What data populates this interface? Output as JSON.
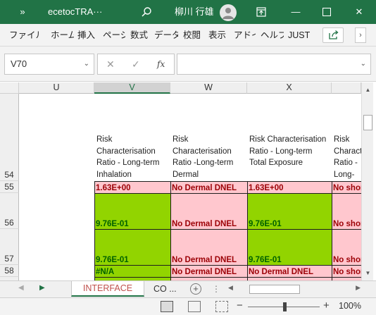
{
  "titlebar": {
    "overflow_glyph": "»",
    "title": "ecetocTRA···",
    "search_icon": "search-icon",
    "user_name": "柳川 行雄",
    "avatar_icon": "person-icon",
    "ribbon_options_glyph": "⊡",
    "minimize_glyph": "—",
    "maximize_glyph": "☐",
    "close_glyph": "✕"
  },
  "ribbon": {
    "tabs": [
      "ファイル",
      "ホーム",
      "挿入",
      "ページ",
      "数式",
      "データ",
      "校閲",
      "表示",
      "アドイン",
      "ヘルプ",
      "JUST"
    ],
    "share_icon": "share-icon",
    "more_glyph": "›"
  },
  "formula_bar": {
    "name_box": "V70",
    "name_box_dropdown": "⌄",
    "cancel_glyph": "✕",
    "enter_glyph": "✓",
    "fx_label": "fx",
    "formula_value": "",
    "expand_glyph": "⌄"
  },
  "grid": {
    "columns": [
      "U",
      "V",
      "W",
      "X"
    ],
    "selected_column": "V",
    "rows": [
      "54",
      "55",
      "56",
      "57",
      "58"
    ],
    "row54": {
      "V": "Risk Characterisation Ratio - Long-term Inhalation",
      "W": "Risk Characterisation Ratio -Long-term Dermal",
      "X": "Risk Characterisation Ratio - Long-term Total Exposure",
      "Y": "Risk Characterisation Ratio - Long-term Inhalation"
    },
    "row55": {
      "V": "1.63E+00",
      "W": "No Dermal DNEL",
      "X": "1.63E+00",
      "Y": "No short-term"
    },
    "row56": {
      "V": "9.76E-01",
      "W": "No Dermal DNEL",
      "X": "9.76E-01",
      "Y": "No short-term"
    },
    "row57": {
      "V": "9.76E-01",
      "W": "No Dermal DNEL",
      "X": "9.76E-01",
      "Y": "No short-term"
    },
    "row58": {
      "V": "#N/A",
      "W": "No Dermal DNEL",
      "X": "No Dermal DNEL",
      "Y": "No short-term"
    }
  },
  "scrollbar": {
    "up_glyph": "▲",
    "down_glyph": "▼"
  },
  "sheets": {
    "prev_glyph": "◀",
    "next_glyph": "▶",
    "active": "INTERFACE",
    "second": "CO ...",
    "add_glyph": "+",
    "separator": "⋮",
    "hscroll_left": "◀",
    "hscroll_right": "▶"
  },
  "status": {
    "zoom_minus": "−",
    "zoom_plus": "+",
    "zoom_level": "100%"
  },
  "colors": {
    "excel_green": "#217346",
    "bad_fill": "#ffc7ce",
    "bad_text": "#9c0006",
    "good_fill": "#92d400",
    "good_text": "#006100"
  }
}
